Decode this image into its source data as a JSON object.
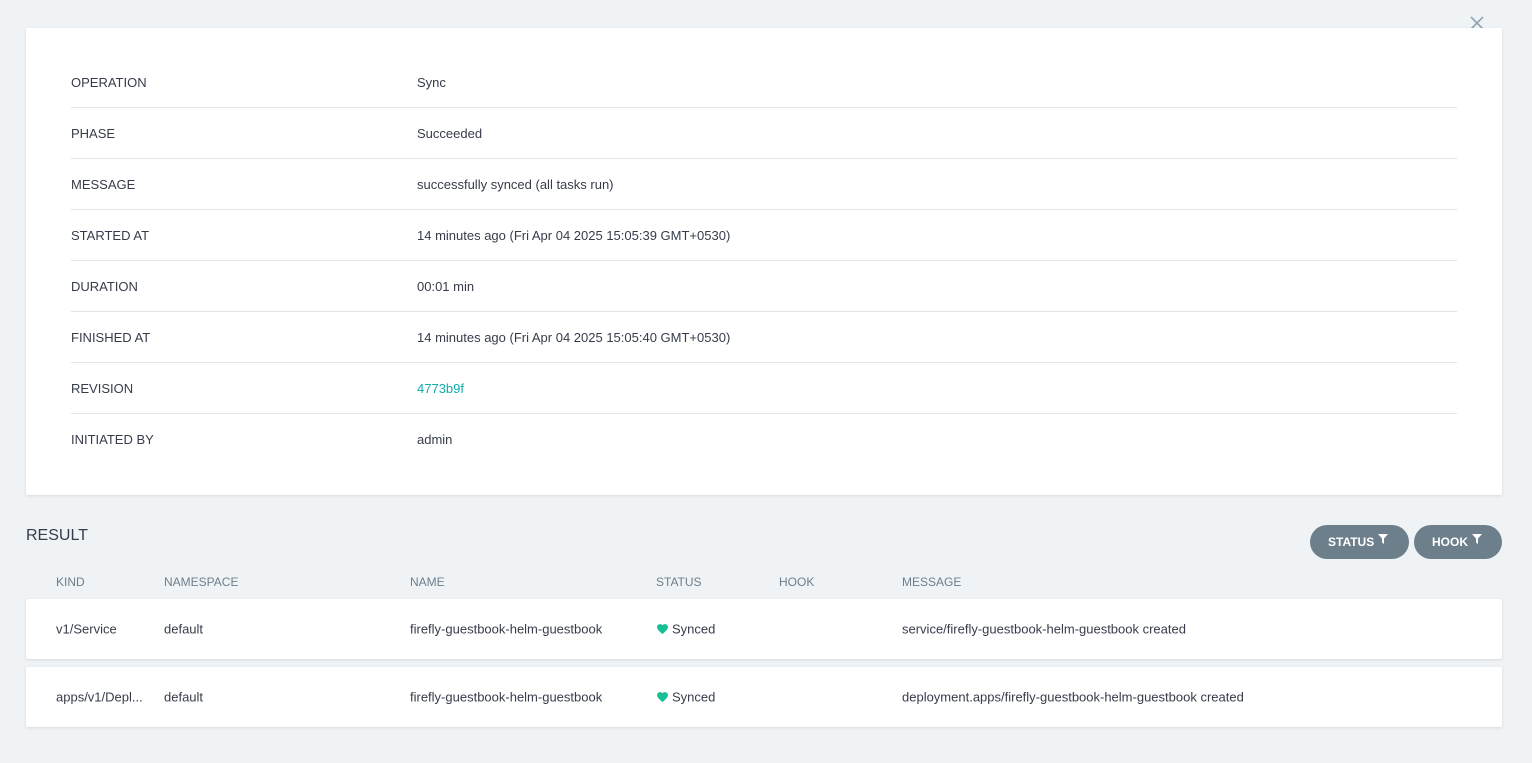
{
  "details": {
    "rows": [
      {
        "label": "OPERATION",
        "value": "Sync"
      },
      {
        "label": "PHASE",
        "value": "Succeeded"
      },
      {
        "label": "MESSAGE",
        "value": "successfully synced (all tasks run)"
      },
      {
        "label": "STARTED AT",
        "value": "14 minutes ago (Fri Apr 04 2025 15:05:39 GMT+0530)"
      },
      {
        "label": "DURATION",
        "value": "00:01 min"
      },
      {
        "label": "FINISHED AT",
        "value": "14 minutes ago (Fri Apr 04 2025 15:05:40 GMT+0530)"
      },
      {
        "label": "REVISION",
        "value": "4773b9f"
      },
      {
        "label": "INITIATED BY",
        "value": "admin"
      }
    ]
  },
  "result": {
    "title": "RESULT",
    "filters": {
      "status_label": "STATUS",
      "hook_label": "HOOK"
    },
    "columns": {
      "kind": "KIND",
      "namespace": "NAMESPACE",
      "name": "NAME",
      "status": "STATUS",
      "hook": "HOOK",
      "message": "MESSAGE"
    },
    "rows": [
      {
        "kind": "v1/Service",
        "namespace": "default",
        "name": "firefly-guestbook-helm-guestbook",
        "status": "Synced",
        "hook": "",
        "message": "service/firefly-guestbook-helm-guestbook created"
      },
      {
        "kind": "apps/v1/Depl...",
        "namespace": "default",
        "name": "firefly-guestbook-helm-guestbook",
        "status": "Synced",
        "hook": "",
        "message": "deployment.apps/firefly-guestbook-helm-guestbook created"
      }
    ]
  },
  "colors": {
    "background": "#eff3f6",
    "link": "#0dadaa",
    "synced": "#18be94",
    "filter_button": "#6d7f8b"
  },
  "icons": {
    "close": "close-icon",
    "filter": "filter-icon",
    "status_synced": "heart-icon"
  }
}
